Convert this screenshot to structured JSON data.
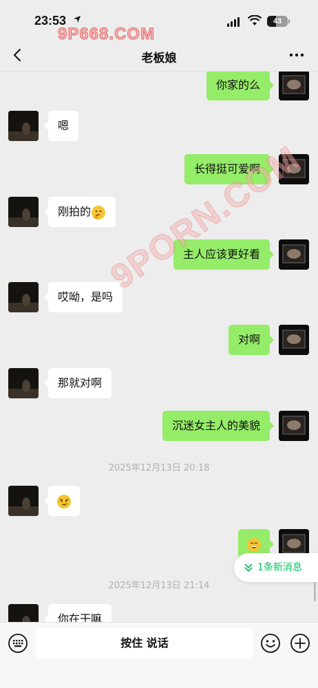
{
  "status_bar": {
    "time": "23:53",
    "battery": "43"
  },
  "watermark_top": "9P668.COM",
  "watermark_diag": "9PORN.COM",
  "nav": {
    "title": "老板娘"
  },
  "messages": [
    {
      "from": "self",
      "text": "你家的么"
    },
    {
      "from": "other",
      "text": "嗯"
    },
    {
      "from": "self",
      "text": "长得挺可爱啊"
    },
    {
      "from": "other",
      "text": "刚拍的",
      "emoji": "thinking-face"
    },
    {
      "from": "self",
      "text": "主人应该更好看"
    },
    {
      "from": "other",
      "text": "哎呦，是吗"
    },
    {
      "from": "self",
      "text": "对啊"
    },
    {
      "from": "other",
      "text": "那就对啊"
    },
    {
      "from": "self",
      "text": "沉迷女主人的美貌"
    },
    {
      "timestamp": "2025年12月13日 20:18"
    },
    {
      "from": "other",
      "emoji": "smirk-face"
    },
    {
      "from": "self",
      "emoji": "grin-face"
    },
    {
      "timestamp": "2025年12月13日 21:14"
    },
    {
      "from": "other",
      "text": "你在干嘛"
    }
  ],
  "new_message_pill": "1条新消息",
  "input_bar": {
    "hold_to_talk": "按住 说话"
  },
  "colors": {
    "self_bubble": "#95ec69",
    "accent": "#07c160",
    "background": "#ededed"
  }
}
